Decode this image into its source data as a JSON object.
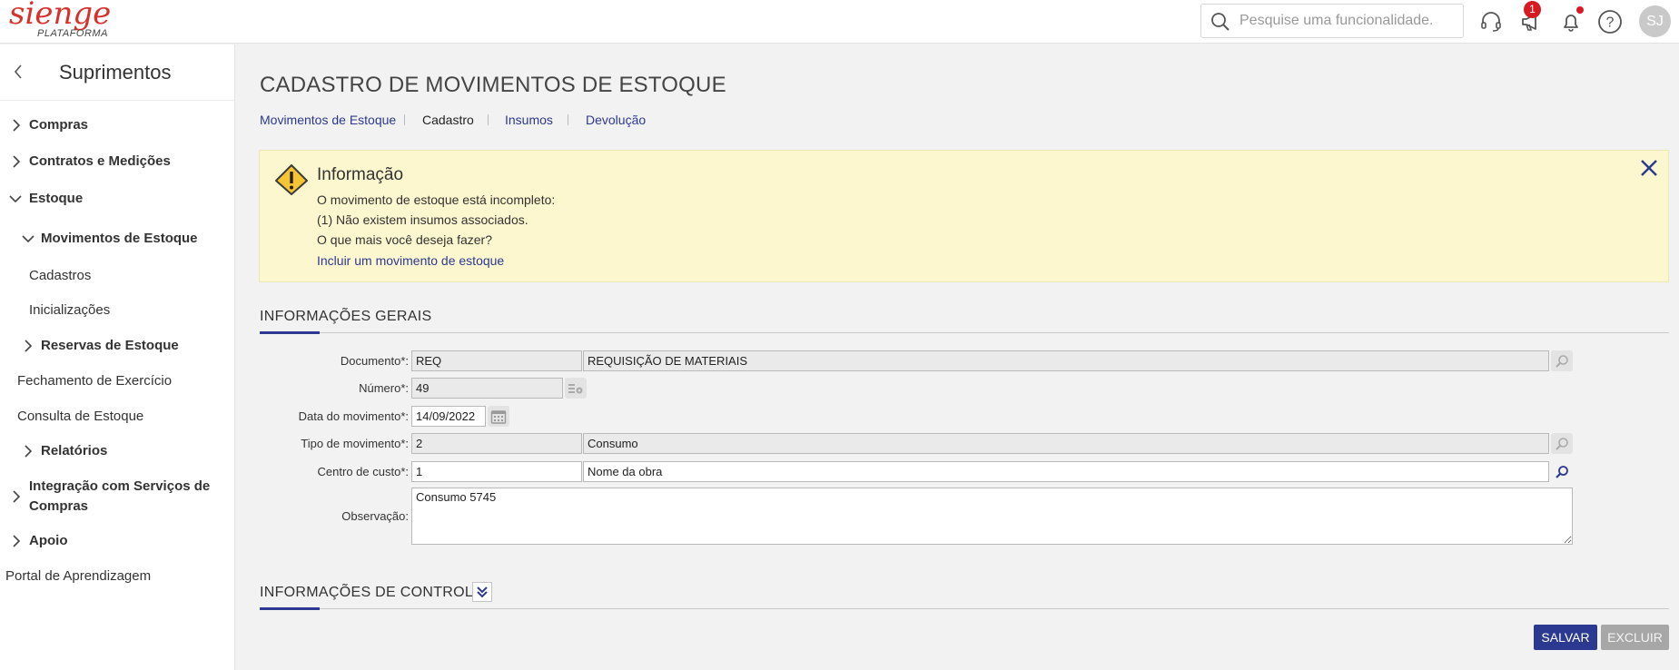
{
  "header": {
    "logo": "sienge",
    "logo_sub": "PLATAFORMA",
    "search_placeholder": "Pesquise uma funcionalidade.",
    "notifications_badge": "1",
    "avatar_initials": "SJ"
  },
  "sidebar": {
    "title": "Suprimentos",
    "items": [
      {
        "label": "Compras"
      },
      {
        "label": "Contratos e Medições"
      },
      {
        "label": "Estoque"
      },
      {
        "label": "Movimentos de Estoque"
      },
      {
        "label": "Cadastros"
      },
      {
        "label": "Inicializações"
      },
      {
        "label": "Reservas de Estoque"
      },
      {
        "label": "Fechamento de Exercício"
      },
      {
        "label": "Consulta de Estoque"
      },
      {
        "label": "Relatórios"
      },
      {
        "label": "Integração com Serviços de"
      },
      {
        "label": "Compras"
      },
      {
        "label": "Apoio"
      },
      {
        "label": "Portal de Aprendizagem"
      }
    ]
  },
  "page": {
    "title": "CADASTRO DE MOVIMENTOS DE ESTOQUE",
    "breadcrumb": [
      "Movimentos de Estoque",
      "Cadastro",
      "Insumos",
      "Devolução"
    ]
  },
  "info": {
    "title": "Informação",
    "lines": [
      "O movimento de estoque está incompleto:",
      "(1) Não existem insumos associados.",
      "O que mais você deseja fazer?"
    ],
    "link": "Incluir um movimento de estoque"
  },
  "general": {
    "title": "INFORMAÇÕES GERAIS",
    "documento_label": "Documento*:",
    "documento_code": "REQ",
    "documento_desc": "REQUISIÇÃO DE MATERIAIS",
    "numero_label": "Número*:",
    "numero": "49",
    "data_label": "Data do movimento*:",
    "data": "14/09/2022",
    "tipo_label": "Tipo de movimento*:",
    "tipo_code": "2",
    "tipo_desc": "Consumo",
    "centro_label": "Centro de custo*:",
    "centro_code": "1",
    "centro_desc": "Nome da obra",
    "obs_label": "Observação:",
    "obs": "Consumo 5745"
  },
  "control": {
    "title": "INFORMAÇÕES DE CONTROLE"
  },
  "actions": {
    "save": "SALVAR",
    "delete": "EXCLUIR"
  },
  "colors": {
    "brand_red": "#d6322b",
    "primary_blue": "#2b3990",
    "info_bg": "#fdf7cf"
  }
}
